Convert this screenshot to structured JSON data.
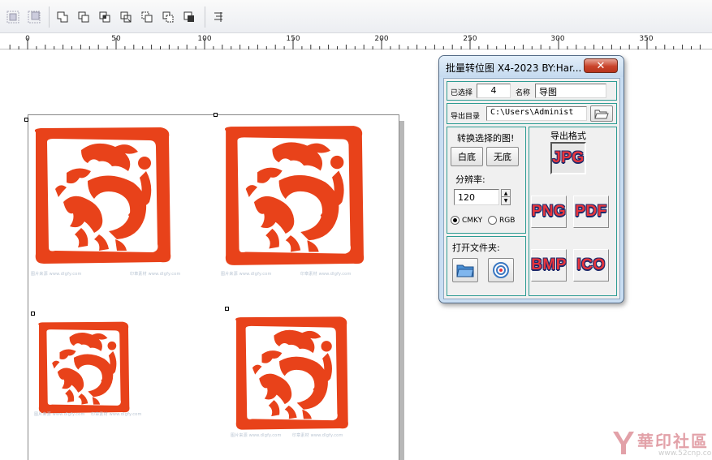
{
  "toolbar": {
    "icons": [
      "align-icon",
      "distribute-icon",
      "weld-icon",
      "trim-icon",
      "intersect-icon",
      "simplify-icon",
      "front-minus-back-icon",
      "back-minus-front-icon",
      "boundary-icon",
      "align-panel-icon"
    ]
  },
  "ruler": {
    "labels": [
      "0",
      "50",
      "100",
      "150",
      "200",
      "250",
      "300",
      "350"
    ]
  },
  "canvas": {
    "seal_color": "#e8421a",
    "captions": [
      "图片来源 www.dlgfy.com",
      "印章素材 www.dlgfy.com",
      "图片来源 www.dlgfy.com",
      "印章素材 www.dlgfy.com"
    ]
  },
  "dialog": {
    "title": "批量转位图 X4-2023 BY:Har...",
    "close_label": "✕",
    "selected_label": "已选择",
    "selected_count": "4",
    "name_label": "名称",
    "name_value": "导图",
    "export_dir_label": "导出目录",
    "export_dir_value": "C:\\Users\\Administ",
    "convert_label": "转换选择的图!",
    "white_bg_button": "白底",
    "no_bg_button": "无底",
    "resolution_label": "分辨率:",
    "resolution_value": "120",
    "color_modes": [
      "CMKY",
      "RGB"
    ],
    "color_mode_selected": "CMKY",
    "open_folder_label": "打开文件夹:",
    "export_format_label": "导出格式",
    "formats": [
      "JPG",
      "PNG",
      "PDF",
      "BMP",
      "ICO"
    ],
    "selected_format": "JPG"
  },
  "watermark": {
    "text": "華印社區",
    "url": "www.52cnp.com"
  }
}
